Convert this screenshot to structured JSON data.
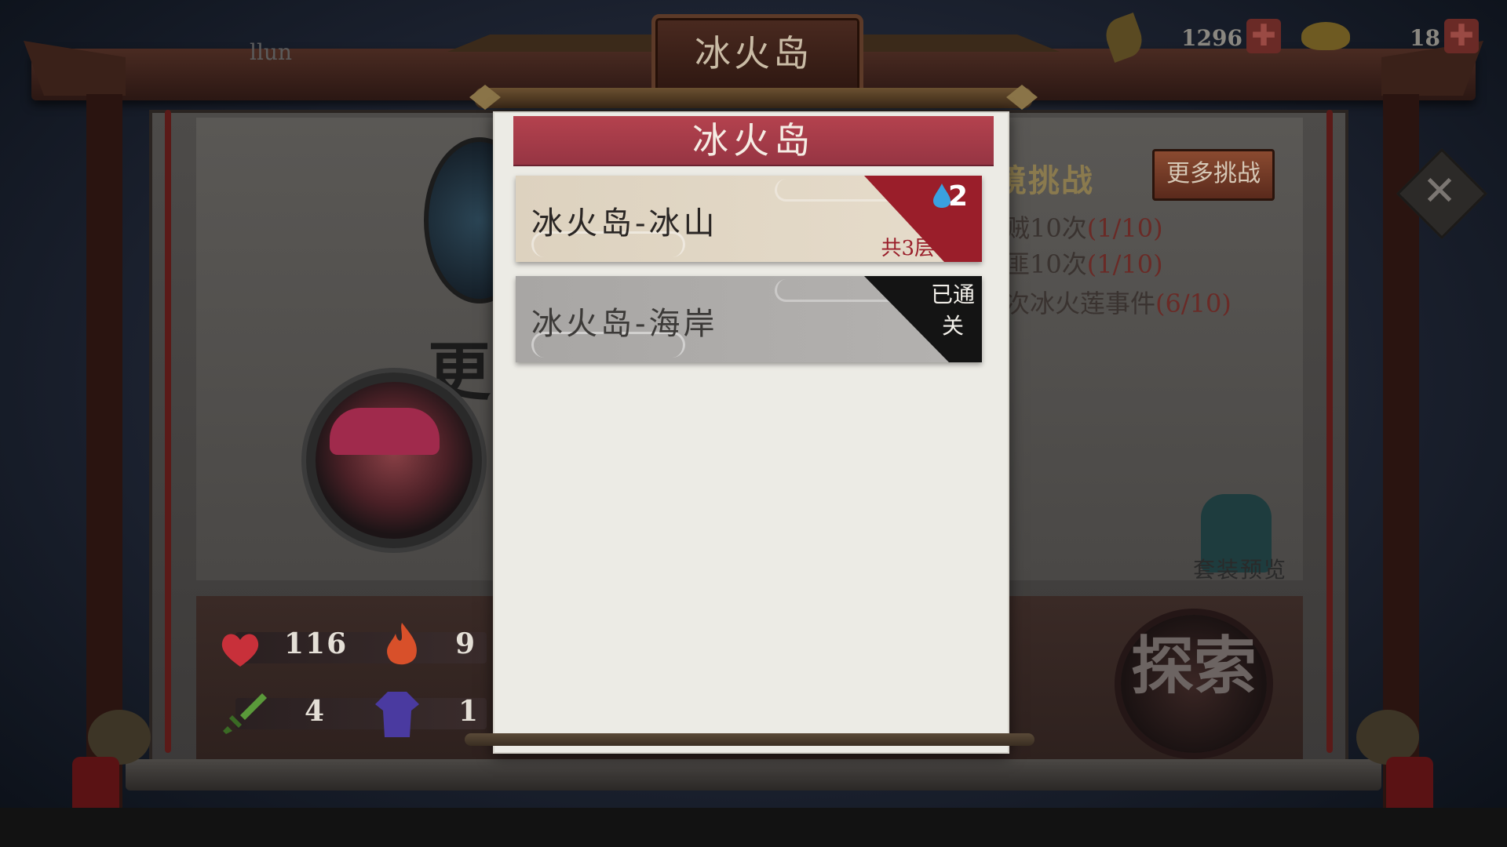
{
  "top_bar": {
    "title": "冰火岛",
    "player_name": "llun",
    "resource_1": "1296",
    "resource_2": "18",
    "plus_glyph": "✚"
  },
  "modal": {
    "title": "冰火岛",
    "levels": [
      {
        "name": "冰火岛-冰山",
        "badge_count": "2",
        "floors": "共3层",
        "accent_color": "#9a1e2a"
      },
      {
        "name": "冰火岛-海岸",
        "status": "已通关"
      }
    ]
  },
  "stats": {
    "hp": "116",
    "fire": "9",
    "attack": "4",
    "defense": "1"
  },
  "challenge": {
    "title": "境挑战",
    "more_button": "更多挑战",
    "tasks": [
      {
        "text": "贼10次",
        "progress": "(1/10)"
      },
      {
        "text": "匪10次",
        "progress": "(1/10)"
      },
      {
        "text": "次冰火莲事件",
        "progress": "(6/10)"
      }
    ]
  },
  "suit_preview": "套装预览",
  "explore_button": "探索",
  "close_glyph": "✕",
  "left_brush_text": "更"
}
